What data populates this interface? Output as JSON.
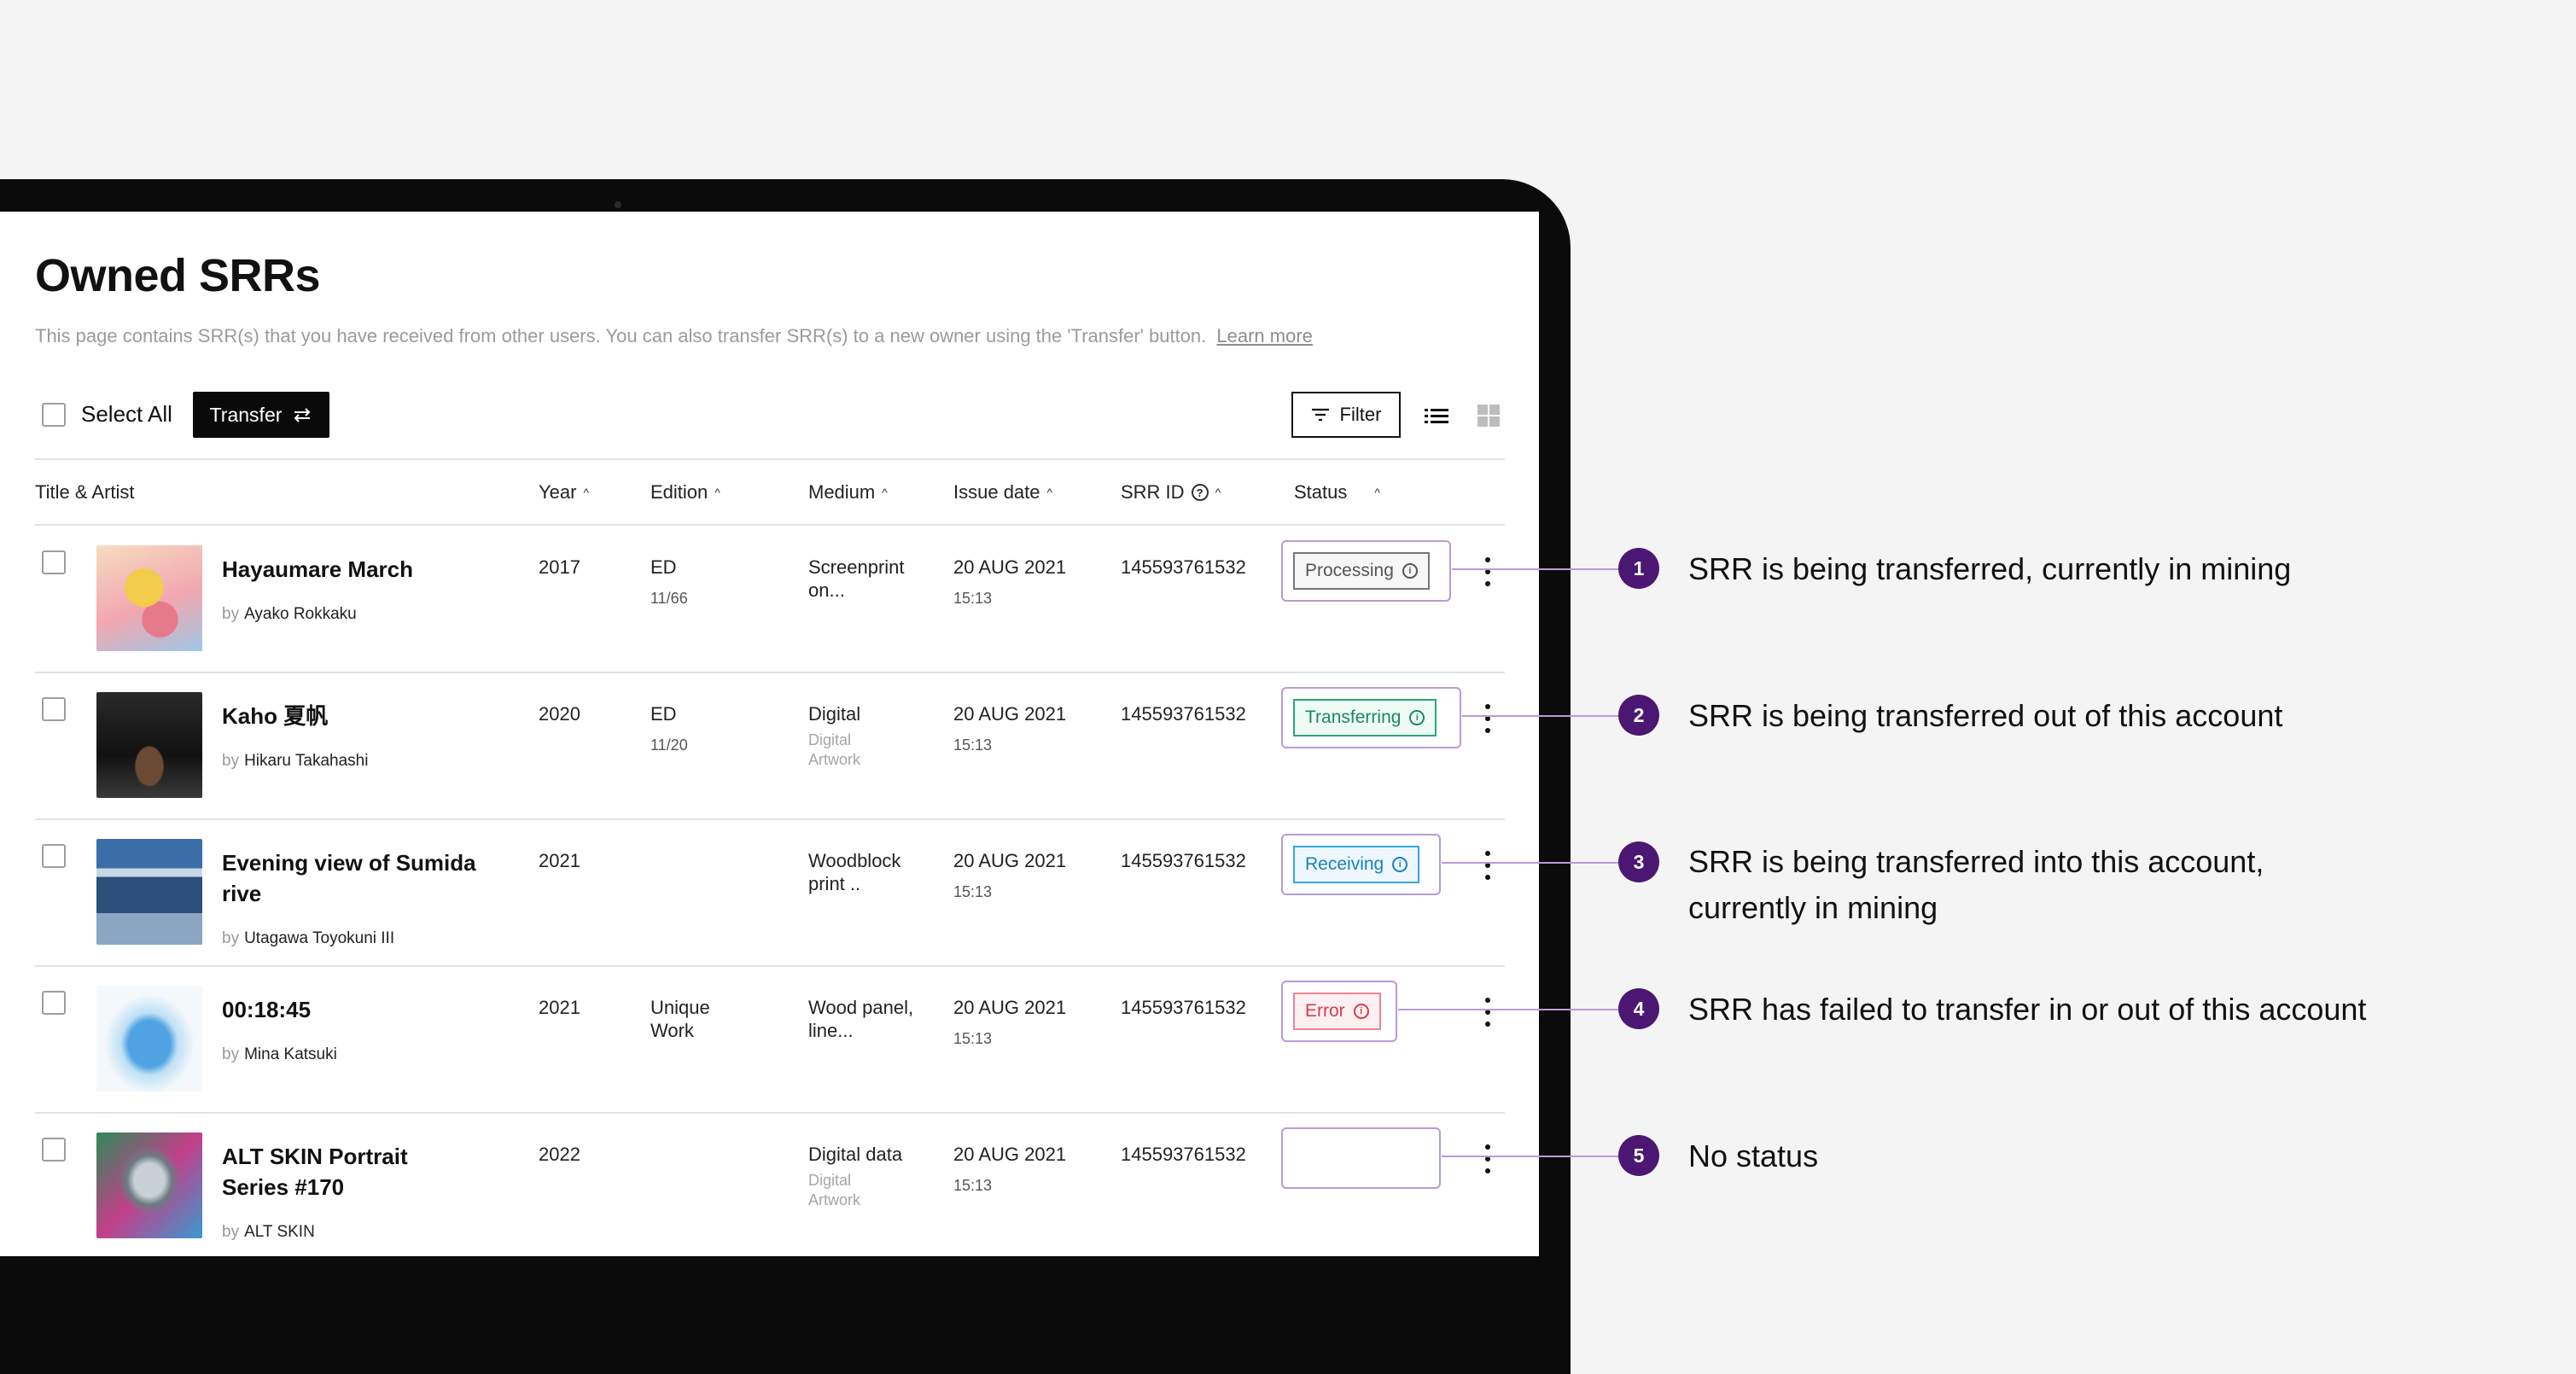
{
  "page": {
    "title": "Owned SRRs",
    "description": "This page contains SRR(s) that you have received from other users. You can also transfer SRR(s) to a new owner using the 'Transfer' button.",
    "learn_more": "Learn more"
  },
  "toolbar": {
    "select_all_label": "Select All",
    "transfer_label": "Transfer",
    "filter_label": "Filter"
  },
  "columns": {
    "title_artist": "Title & Artist",
    "year": "Year",
    "edition": "Edition",
    "medium": "Medium",
    "issue_date": "Issue date",
    "srr_id": "SRR ID",
    "status": "Status"
  },
  "rows": [
    {
      "title": "Hayaumare March",
      "by": "by",
      "artist": "Ayako Rokkaku",
      "year": "2017",
      "edition": "ED",
      "edition_sub": "11/66",
      "medium": "Screenprint on...",
      "medium_sub": "",
      "date": "20 AUG 2021",
      "time": "15:13",
      "srr_id": "145593761532",
      "status": "Processing"
    },
    {
      "title": "Kaho 夏帆",
      "by": "by",
      "artist": "Hikaru Takahashi",
      "year": "2020",
      "edition": "ED",
      "edition_sub": "11/20",
      "medium": "Digital",
      "medium_sub": "Digital Artwork",
      "date": "20 AUG 2021",
      "time": "15:13",
      "srr_id": "145593761532",
      "status": "Transferring"
    },
    {
      "title": "Evening view of Sumida rive",
      "by": "by",
      "artist": "Utagawa Toyokuni III",
      "year": "2021",
      "edition": "",
      "edition_sub": "",
      "medium": "Woodblock print ..",
      "medium_sub": "",
      "date": "20 AUG 2021",
      "time": "15:13",
      "srr_id": "145593761532",
      "status": "Receiving"
    },
    {
      "title": "00:18:45",
      "by": "by",
      "artist": "Mina Katsuki",
      "year": "2021",
      "edition": "Unique Work",
      "edition_sub": "",
      "medium": "Wood panel, line...",
      "medium_sub": "",
      "date": "20 AUG 2021",
      "time": "15:13",
      "srr_id": "145593761532",
      "status": "Error"
    },
    {
      "title": "ALT SKIN Portrait Series #170",
      "by": "by",
      "artist": "ALT SKIN",
      "year": "2022",
      "edition": "",
      "edition_sub": "",
      "medium": "Digital data",
      "medium_sub": "Digital Artwork",
      "date": "20 AUG 2021",
      "time": "15:13",
      "srr_id": "145593761532",
      "status": ""
    }
  ],
  "callouts": [
    {
      "number": "1",
      "text": "SRR is being transferred, currently in mining"
    },
    {
      "number": "2",
      "text": "SRR is being transferred out of this account"
    },
    {
      "number": "3",
      "text": "SRR is being transferred into this account, currently in mining"
    },
    {
      "number": "4",
      "text": "SRR has failed to transfer in or out of this account"
    },
    {
      "number": "5",
      "text": "No status"
    }
  ],
  "colors": {
    "processing": "#555555",
    "transferring": "#1a8a5a",
    "receiving": "#1a7fc4",
    "error": "#d93a50",
    "callout": "#4b1773",
    "status_frame": "#b79cd5"
  },
  "icons": [
    "checkbox-icon",
    "transfer-arrows-icon",
    "filter-icon",
    "list-view-icon",
    "grid-view-icon",
    "help-icon",
    "sort-caret-icon",
    "info-icon",
    "kebab-menu-icon"
  ]
}
